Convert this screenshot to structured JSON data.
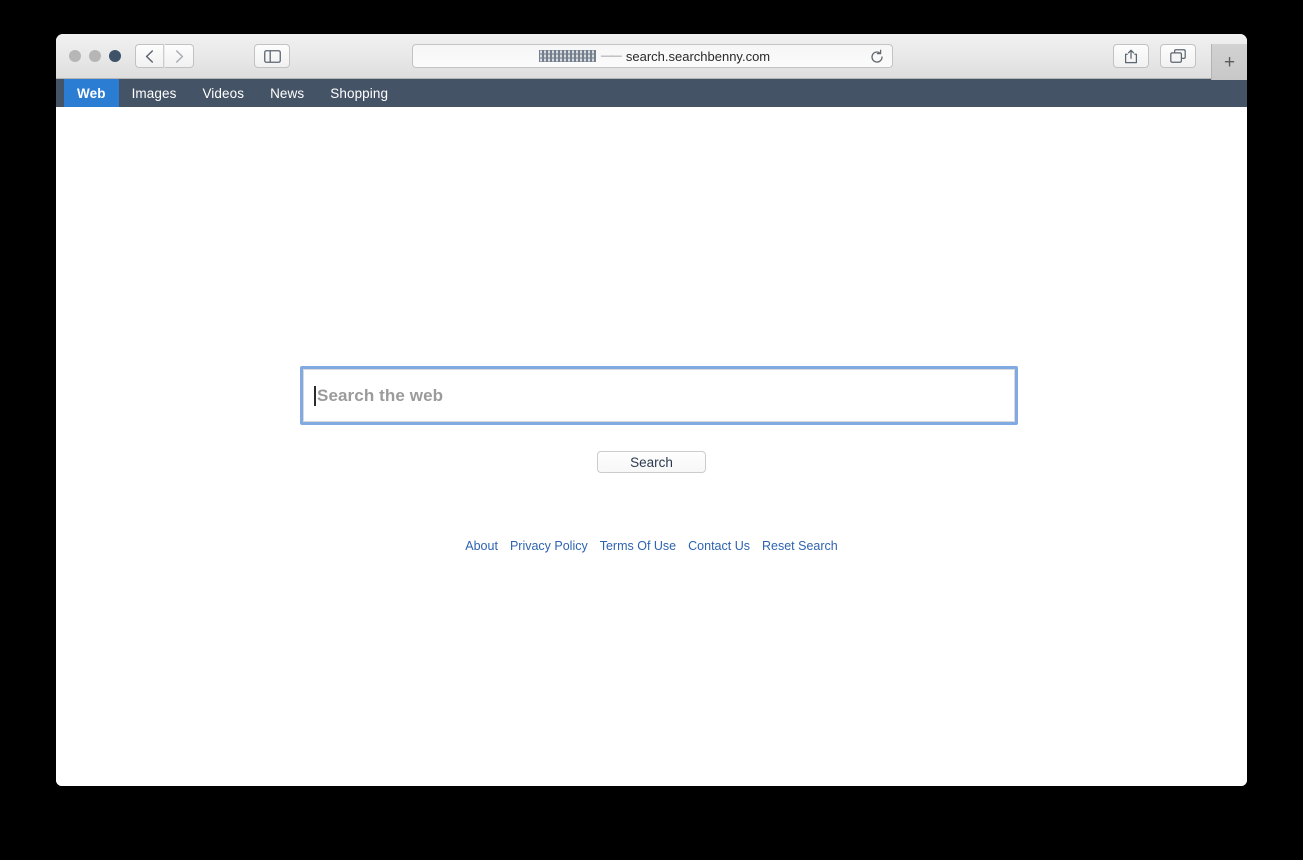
{
  "window": {
    "traffic_lights": [
      "close",
      "minimize",
      "zoom"
    ]
  },
  "toolbar": {
    "back_icon": "chevron-left-icon",
    "forward_icon": "chevron-right-icon",
    "sidebar_icon": "show-sidebar-icon",
    "share_icon": "share-icon",
    "tabs_icon": "show-tabs-icon",
    "new_tab_label": "+",
    "reload_icon": "reload-icon",
    "url_prefix_redacted": "",
    "url_separator": "——",
    "url_text": "search.searchbenny.com"
  },
  "site_nav": {
    "items": [
      {
        "label": "Web",
        "active": true
      },
      {
        "label": "Images",
        "active": false
      },
      {
        "label": "Videos",
        "active": false
      },
      {
        "label": "News",
        "active": false
      },
      {
        "label": "Shopping",
        "active": false
      }
    ]
  },
  "main": {
    "search_value": "",
    "search_placeholder": "Search the web",
    "search_button_label": "Search"
  },
  "footer": {
    "links": [
      {
        "label": "About"
      },
      {
        "label": "Privacy Policy"
      },
      {
        "label": "Terms Of Use"
      },
      {
        "label": "Contact Us"
      },
      {
        "label": "Reset Search"
      }
    ]
  },
  "colors": {
    "nav_bar_bg": "#445365",
    "nav_active_bg": "#2b7cd3",
    "focus_border": "#82aae2",
    "link": "#2e63b0",
    "placeholder": "#9b9b9b",
    "desktop_bg": "#000000"
  }
}
